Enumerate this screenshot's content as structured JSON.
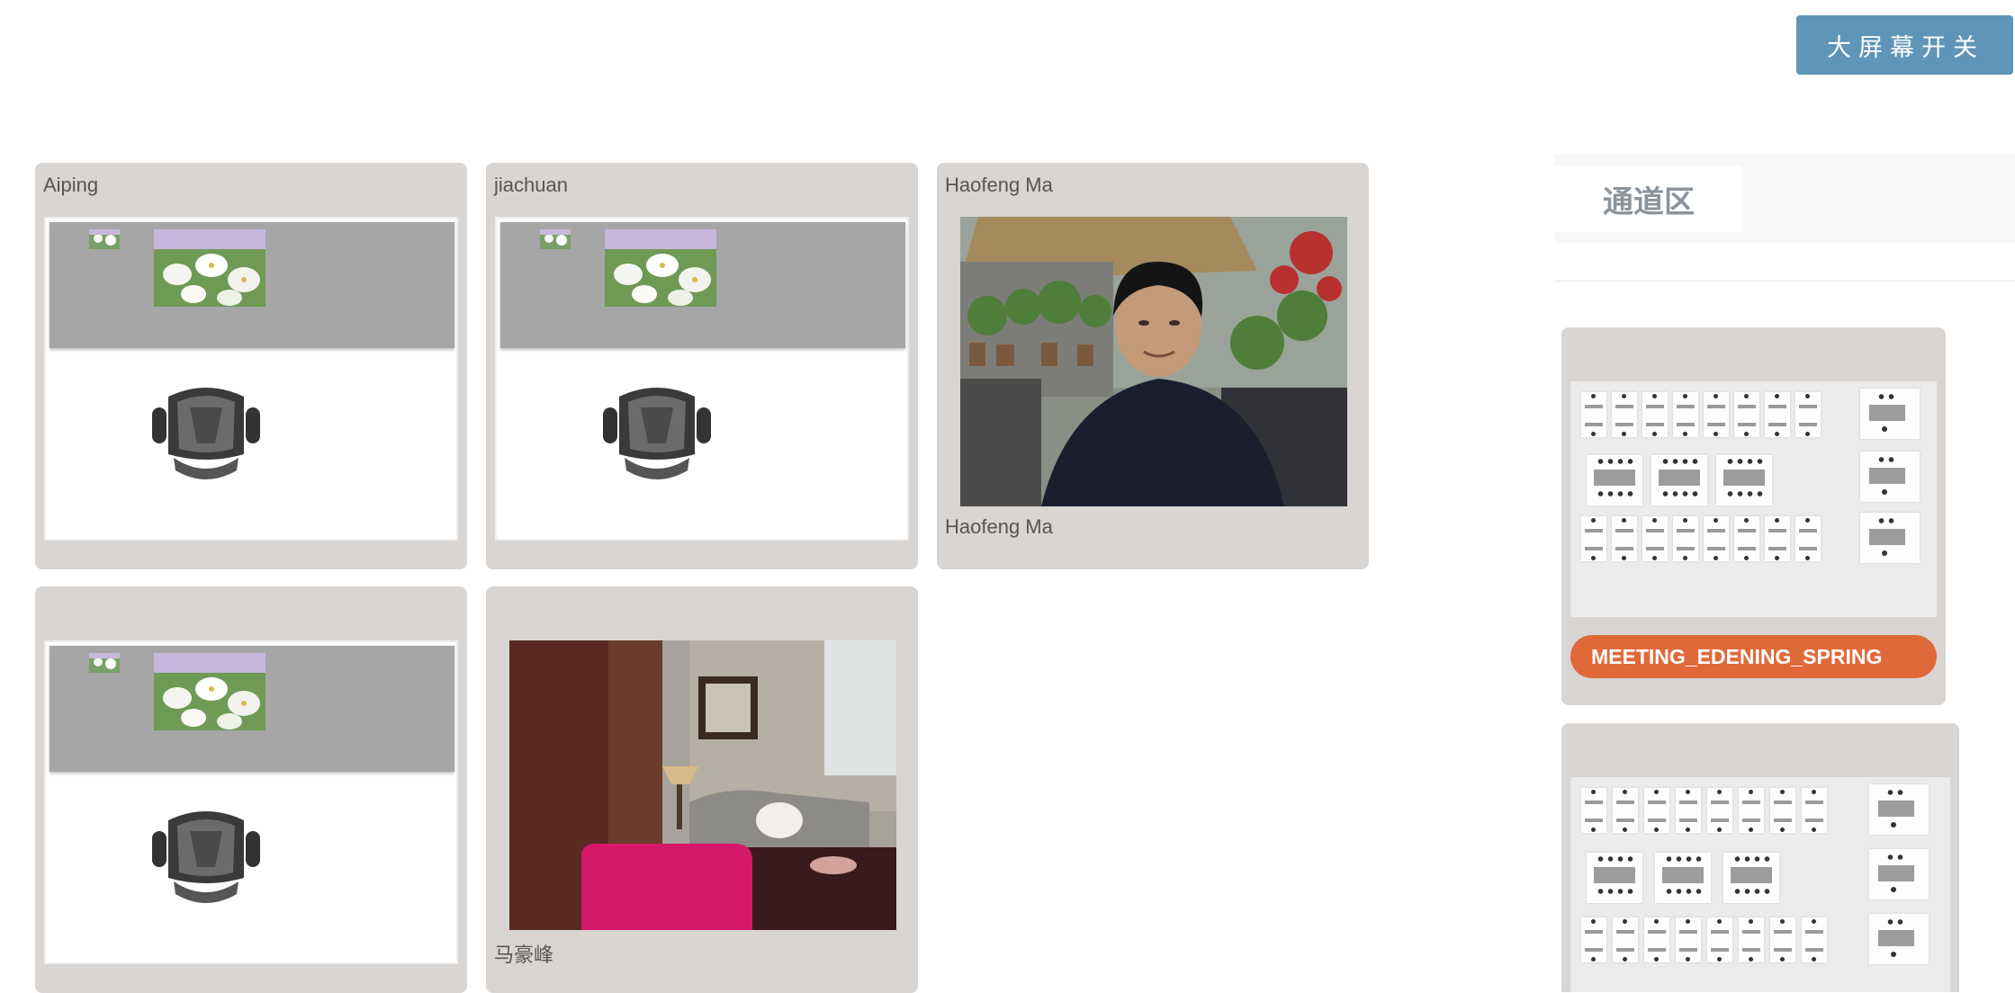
{
  "header": {
    "big_screen_button": "大屏幕开关"
  },
  "tiles": [
    {
      "title": "Aiping",
      "caption": ""
    },
    {
      "title": "jiachuan",
      "caption": ""
    },
    {
      "title": "Haofeng Ma",
      "caption": "Haofeng Ma"
    },
    {
      "title": "",
      "caption": ""
    },
    {
      "title": "",
      "caption": "马豪峰"
    }
  ],
  "sidebar": {
    "tab_label": "通道区",
    "maps": [
      {
        "label": "MEETING_EDENING_SPRING"
      },
      {
        "label": ""
      }
    ]
  },
  "colors": {
    "button_blue": "#5f95b6",
    "tile_bg": "#d9d5d2",
    "map_label_orange": "#e0693a",
    "wall_gray": "#a6a6a6"
  }
}
